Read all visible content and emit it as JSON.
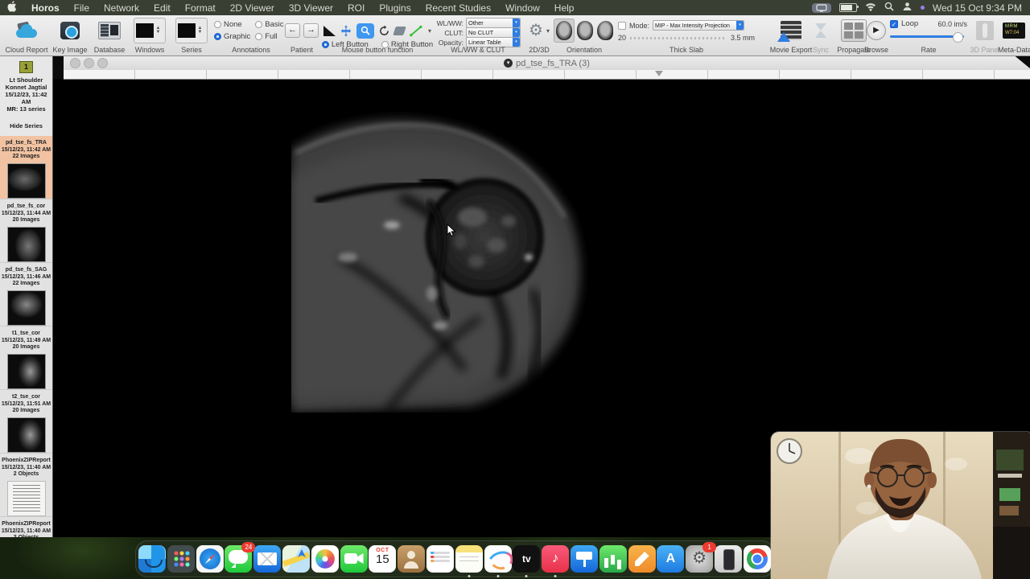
{
  "menu_bar": {
    "items": [
      "Horos",
      "File",
      "Network",
      "Edit",
      "Format",
      "2D Viewer",
      "3D Viewer",
      "ROI",
      "Plugins",
      "Recent Studies",
      "Window",
      "Help"
    ],
    "clock": "Wed 15 Oct  9:34 PM"
  },
  "toolbar": {
    "labels": {
      "cloud_report": "Cloud Report",
      "key_image": "Key Image",
      "database": "Database",
      "windows": "Windows",
      "series": "Series",
      "annotations": "Annotations",
      "patient": "Patient",
      "mouse": "Mouse button function",
      "wlww": "WL/WW & CLUT",
      "d2d3": "2D/3D",
      "orientation": "Orientation",
      "thick_slab": "Thick Slab",
      "movie_export": "Movie Export",
      "sync": "Sync",
      "propagate": "Propagate",
      "browse": "Browse",
      "rate": "Rate",
      "panel3d": "3D Panel",
      "metadata": "Meta-Data"
    },
    "annotations": {
      "none": "None",
      "graphic": "Graphic",
      "basic": "Basic",
      "full": "Full",
      "selected": "Graphic"
    },
    "mouse": {
      "left": "Left Button",
      "right": "Right Button",
      "selected": "Left Button"
    },
    "wlww": {
      "l1": "WL/WW:",
      "v1": "Other",
      "l2": "CLUT:",
      "v2": "No CLUT",
      "l3": "Opacity:",
      "v3": "Linear Table"
    },
    "thick_slab": {
      "mode_label": "Mode:",
      "mode_value": "MIP - Max Intensity Projection",
      "slices": "20",
      "thickness": "3.5 mm"
    },
    "rate": {
      "loop_label": "Loop",
      "value": "60.0 im/s"
    }
  },
  "sidebar": {
    "badge": "1",
    "patient": {
      "l1": "Lt Shoulder",
      "l2": "Konnet Jagtial",
      "l3": "15/12/23, 11:42 AM",
      "l4": "MR: 13 series"
    },
    "hide_series": "Hide Series",
    "series": [
      {
        "name": "pd_tse_fs_TRA",
        "date": "15/12/23, 11:42 AM",
        "count": "22 Images",
        "selected": true
      },
      {
        "name": "pd_tse_fs_cor",
        "date": "15/12/23, 11:44 AM",
        "count": "20 Images",
        "selected": false
      },
      {
        "name": "pd_tse_fs_SAG",
        "date": "15/12/23, 11:46 AM",
        "count": "22 Images",
        "selected": false
      },
      {
        "name": "t1_tse_cor",
        "date": "15/12/23, 11:49 AM",
        "count": "20 Images",
        "selected": false
      },
      {
        "name": "t2_tse_cor",
        "date": "15/12/23, 11:51 AM",
        "count": "20 Images",
        "selected": false
      },
      {
        "name": "PhoenixZIPReport",
        "date": "15/12/23, 11:40 AM",
        "count": "2 Objects",
        "selected": false
      },
      {
        "name": "PhoenixZIPReport",
        "date": "15/12/23, 11:40 AM",
        "count": "2 Objects",
        "selected": false
      }
    ]
  },
  "viewer": {
    "title": "pd_tse_fs_TRA (3)"
  },
  "dock": {
    "messages_badge": "24",
    "settings_badge": "1",
    "calendar_month": "OCT",
    "calendar_day": "15",
    "items": [
      "finder",
      "launchpad",
      "safari",
      "messages",
      "mail",
      "maps",
      "photos",
      "facetime",
      "calendar",
      "contacts",
      "reminders",
      "notes",
      "freeform",
      "tv",
      "music",
      "keynote",
      "numbers",
      "pages",
      "app-store",
      "system-settings",
      "iphone-mirroring",
      "chrome"
    ]
  },
  "colors": {
    "accent_blue": "#2f7de1",
    "selected_series": "#f1c3a3",
    "measure_green": "#35c135",
    "menubar": "#3a3f33"
  }
}
